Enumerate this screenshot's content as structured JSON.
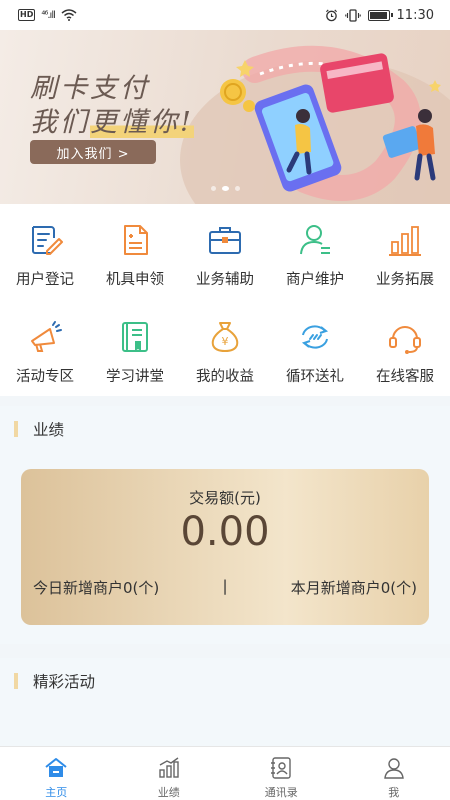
{
  "status_bar": {
    "hd": "HD",
    "network": "⁴⁶.ıll",
    "time": "11:30"
  },
  "banner": {
    "line1": "刷卡支付",
    "line2_pre": "我们",
    "line2_hl": "更懂你!",
    "cta": "加入我们 >",
    "dots_total": 3,
    "active_dot": 2
  },
  "grid": [
    {
      "label": "用户登记",
      "icon": "user-register-icon"
    },
    {
      "label": "机具申领",
      "icon": "device-apply-icon"
    },
    {
      "label": "业务辅助",
      "icon": "briefcase-icon"
    },
    {
      "label": "商户维护",
      "icon": "merchant-icon"
    },
    {
      "label": "业务拓展",
      "icon": "bar-growth-icon"
    },
    {
      "label": "活动专区",
      "icon": "megaphone-icon"
    },
    {
      "label": "学习讲堂",
      "icon": "book-icon"
    },
    {
      "label": "我的收益",
      "icon": "money-bag-icon"
    },
    {
      "label": "循环送礼",
      "icon": "cycle-icon"
    },
    {
      "label": "在线客服",
      "icon": "headset-icon"
    }
  ],
  "performance": {
    "title": "业绩",
    "caption": "交易额(元)",
    "amount": "0.00",
    "today": "今日新增商户0(个)",
    "divider": "|",
    "month": "本月新增商户0(个)"
  },
  "activities": {
    "title": "精彩活动"
  },
  "tabs": [
    {
      "label": "主页",
      "icon": "home-icon",
      "active": true
    },
    {
      "label": "业绩",
      "icon": "chart-icon",
      "active": false
    },
    {
      "label": "通讯录",
      "icon": "contacts-icon",
      "active": false
    },
    {
      "label": "我",
      "icon": "person-icon",
      "active": false
    }
  ],
  "colors": {
    "accent": "#2f8ce8",
    "card_gold": "#dcc29a",
    "bar_gold": "#f1d8a3"
  }
}
